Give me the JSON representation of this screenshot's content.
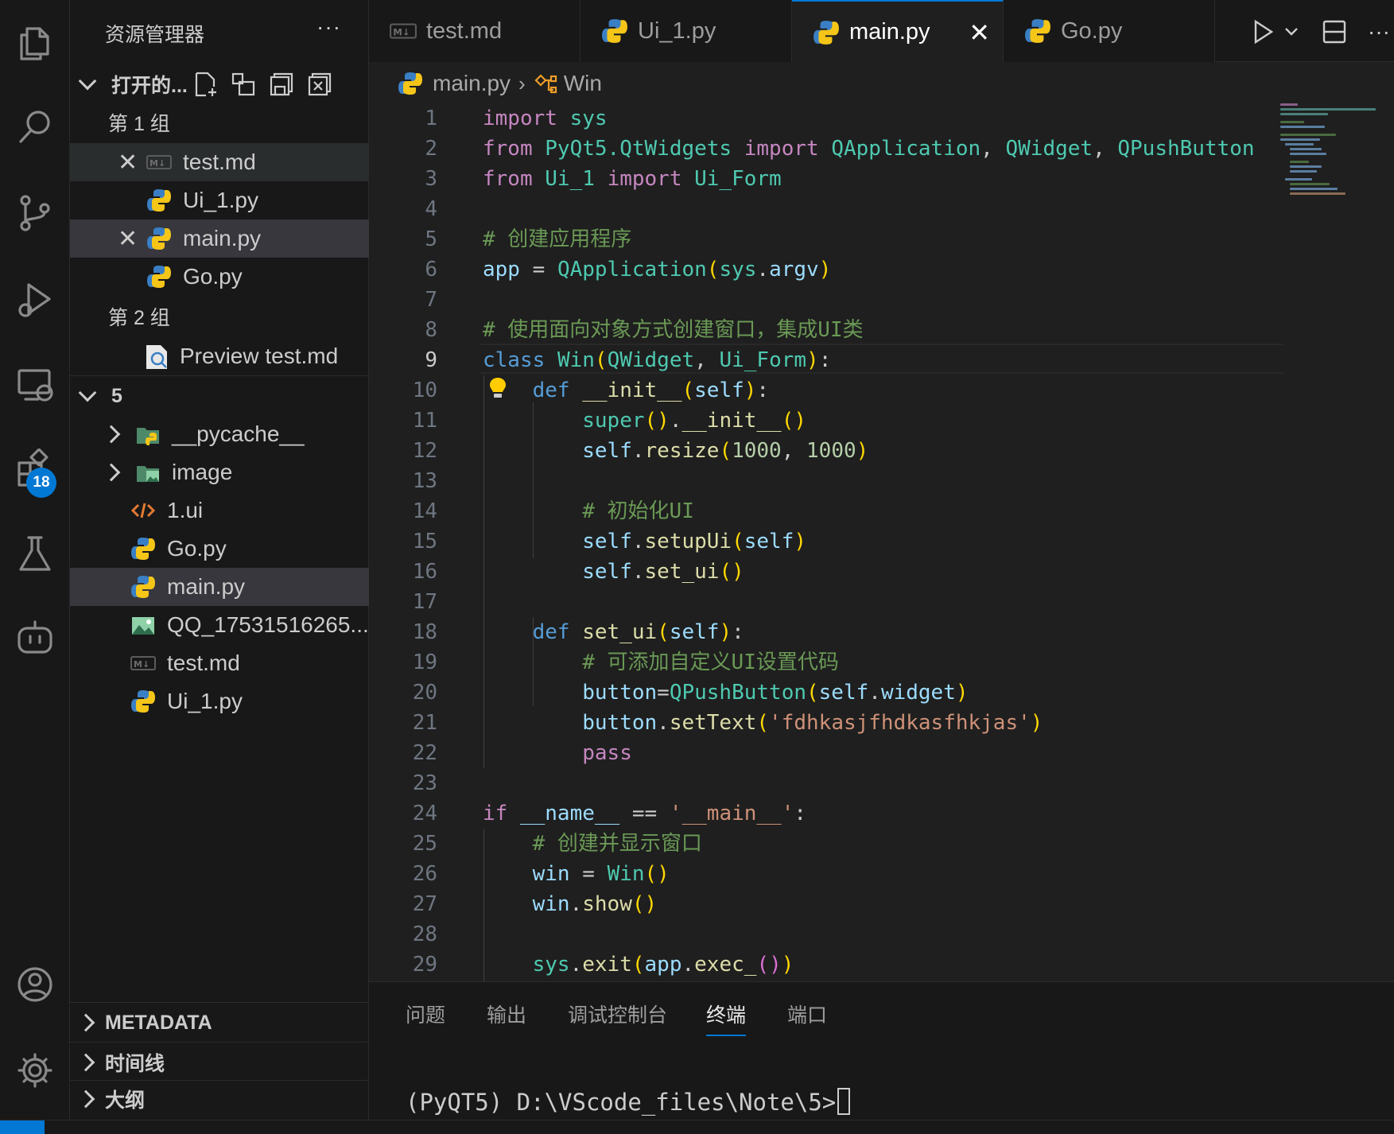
{
  "activity_bar": {
    "icons": [
      "explorer-icon",
      "search-icon",
      "source-control-icon",
      "run-debug-icon",
      "remote-explorer-icon",
      "extensions-icon",
      "testing-icon",
      "copilot-icon",
      "account-icon",
      "settings-gear-icon"
    ],
    "extensions_badge": "18"
  },
  "sidebar": {
    "title": "资源管理器",
    "more": "···",
    "open_editors": {
      "label": "打开的...",
      "group1_label": "第 1 组",
      "group2_label": "第 2 组",
      "group1": [
        "test.md",
        "Ui_1.py",
        "main.py",
        "Go.py"
      ],
      "group2": [
        "Preview test.md"
      ]
    },
    "folder": {
      "label": "5",
      "items": [
        "__pycache__",
        "image",
        "1.ui",
        "Go.py",
        "main.py",
        "QQ_17531516265...",
        "test.md",
        "Ui_1.py"
      ]
    },
    "sections": [
      "METADATA",
      "时间线",
      "大纲"
    ]
  },
  "tabs": [
    "test.md",
    "Ui_1.py",
    "main.py",
    "Go.py"
  ],
  "breadcrumb": {
    "file": "main.py",
    "symbol": "Win"
  },
  "editor": {
    "current_line": "9"
  },
  "panel": {
    "tabs": [
      "问题",
      "输出",
      "调试控制台",
      "终端",
      "端口"
    ],
    "terminal_prompt": "(PyQT5) D:\\VScode_files\\Note\\5>"
  },
  "colors": {
    "accent": "#0078d4",
    "editor_bg": "#1f1f1f",
    "sidebar_bg": "#181818"
  }
}
